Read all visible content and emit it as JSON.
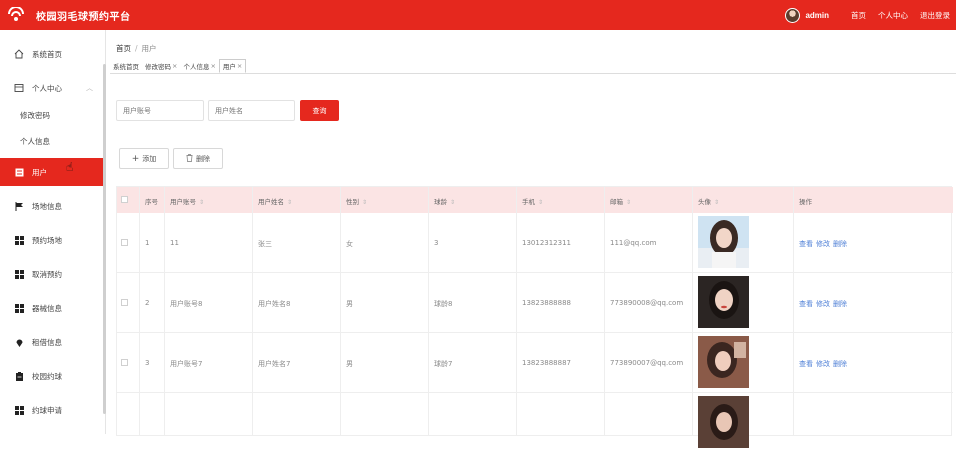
{
  "app": {
    "title": "校园羽毛球预约平台"
  },
  "header": {
    "user": "admin",
    "links": [
      "首页",
      "个人中心",
      "退出登录"
    ]
  },
  "sidebar": {
    "items": [
      {
        "label": "系统首页",
        "icon": "home-icon"
      },
      {
        "label": "个人中心",
        "icon": "user-center-icon"
      },
      {
        "label": "修改密码",
        "sub": true
      },
      {
        "label": "个人信息",
        "sub": true
      },
      {
        "label": "用户",
        "icon": "grid-icon",
        "active": true
      },
      {
        "label": "场地信息",
        "icon": "flag-icon"
      },
      {
        "label": "预约场地",
        "icon": "apps-icon"
      },
      {
        "label": "取消预约",
        "icon": "apps-icon"
      },
      {
        "label": "器械信息",
        "icon": "apps-icon"
      },
      {
        "label": "租借信息",
        "icon": "pin-icon"
      },
      {
        "label": "校园约球",
        "icon": "clipboard-icon"
      },
      {
        "label": "约球申请",
        "icon": "apps-icon"
      }
    ]
  },
  "breadcrumb": {
    "home": "首页",
    "current": "用户"
  },
  "tabs": [
    {
      "label": "系统首页",
      "closable": false
    },
    {
      "label": "修改密码",
      "closable": true
    },
    {
      "label": "个人信息",
      "closable": true
    },
    {
      "label": "用户",
      "closable": true,
      "active": true
    }
  ],
  "search": {
    "account_placeholder": "用户账号",
    "name_placeholder": "用户姓名",
    "query_label": "查询"
  },
  "actions": {
    "add_label": "添加",
    "delete_label": "删除"
  },
  "table": {
    "columns": [
      "序号",
      "用户账号",
      "用户姓名",
      "性别",
      "球龄",
      "手机",
      "邮箱",
      "头像",
      "操作"
    ],
    "rows": [
      {
        "index": "1",
        "account": "11",
        "name": "张三",
        "gender": "女",
        "age": "3",
        "phone": "13012312311",
        "email": "111@qq.com"
      },
      {
        "index": "2",
        "account": "用户账号8",
        "name": "用户姓名8",
        "gender": "男",
        "age": "球龄8",
        "phone": "13823888888",
        "email": "773890008@qq.com"
      },
      {
        "index": "3",
        "account": "用户账号7",
        "name": "用户姓名7",
        "gender": "男",
        "age": "球龄7",
        "phone": "13823888887",
        "email": "773890007@qq.com"
      }
    ],
    "row_actions": [
      "查看",
      "修改",
      "删除"
    ]
  },
  "colors": {
    "brand": "#e5281e",
    "link": "#4e7fd6",
    "header_row": "#fbe4e4"
  }
}
